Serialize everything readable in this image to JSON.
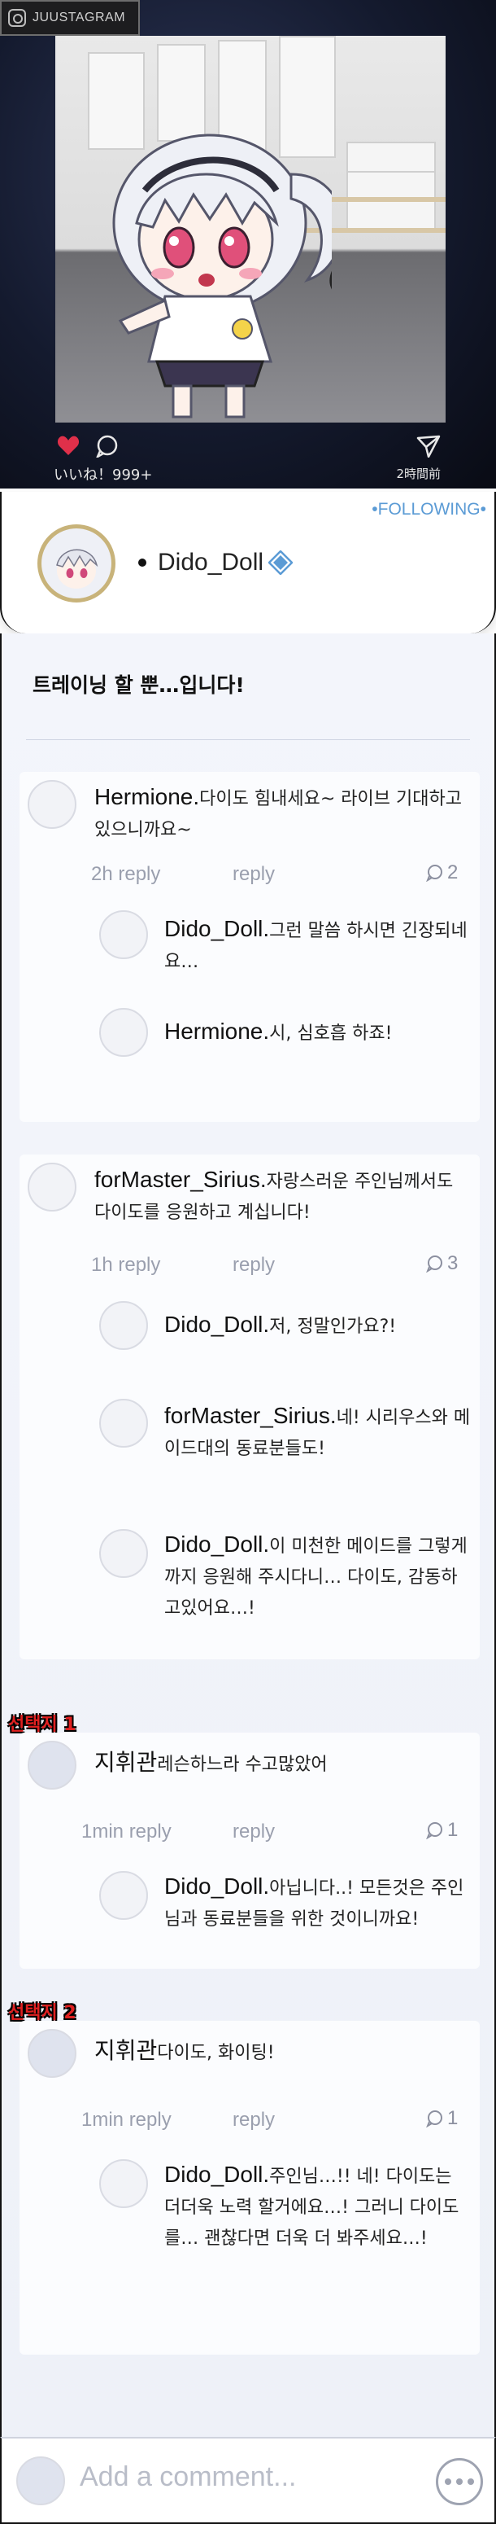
{
  "app": {
    "name": "JUUSTAGRAM"
  },
  "post": {
    "likes": "いいね！999+",
    "time": "2時間前",
    "caption": "트레이닝 할 뿐…입니다!"
  },
  "profile": {
    "following": "•FOLLOWING•",
    "name": "Dido_Doll"
  },
  "threads": [
    {
      "user": "Hermione.",
      "text": "다이도 힘내세요~ 라이브 기대하고 있으니까요~",
      "time": "2h reply",
      "reply_label": "reply",
      "reply_count": "2",
      "replies": [
        {
          "user": "Dido_Doll.",
          "text": "그런 말씀 하시면 긴장되네요…"
        },
        {
          "user": "Hermione.",
          "text": "시, 심호흡 하죠!"
        }
      ]
    },
    {
      "user": "forMaster_Sirius.",
      "text": "자랑스러운 주인님께서도 다이도를 응원하고 계십니다!",
      "time": "1h reply",
      "reply_label": "reply",
      "reply_count": "3",
      "replies": [
        {
          "user": "Dido_Doll.",
          "text": "저, 정말인가요?!"
        },
        {
          "user": "forMaster_Sirius.",
          "text": "네! 시리우스와 메이드대의 동료분들도!"
        },
        {
          "user": "Dido_Doll.",
          "text": "이 미천한 메이드를 그렇게까지 응원해 주시다니… 다이도, 감동하고있어요…!"
        }
      ]
    },
    {
      "choice_label": "선택지 1",
      "user": "지휘관",
      "text": "레슨하느라 수고많았어",
      "time": "1min reply",
      "reply_label": "reply",
      "reply_count": "1",
      "replies": [
        {
          "user": "Dido_Doll.",
          "text": "아닙니다..! 모든것은 주인님과 동료분들을 위한 것이니까요!"
        }
      ]
    },
    {
      "choice_label": "선택지 2",
      "user": "지휘관",
      "text": "다이도, 화이팅!",
      "time": "1min reply",
      "reply_label": "reply",
      "reply_count": "1",
      "replies": [
        {
          "user": "Dido_Doll.",
          "text": "주인님…!! 네! 다이도는 더더욱 노력 할거에요…! 그러니 다이도를… 괜찮다면 더욱 더 봐주세요…!"
        }
      ]
    }
  ],
  "composer": {
    "placeholder": "Add a comment..."
  },
  "icons": {
    "heart": "heart-icon",
    "comment": "comment-bubble-icon",
    "share": "paper-plane-icon",
    "verified": "verified-badge-icon",
    "more": "more-dots-icon"
  },
  "colors": {
    "accent": "#5b9bd5",
    "heart": "#e0304a",
    "choice": "#e02020"
  }
}
